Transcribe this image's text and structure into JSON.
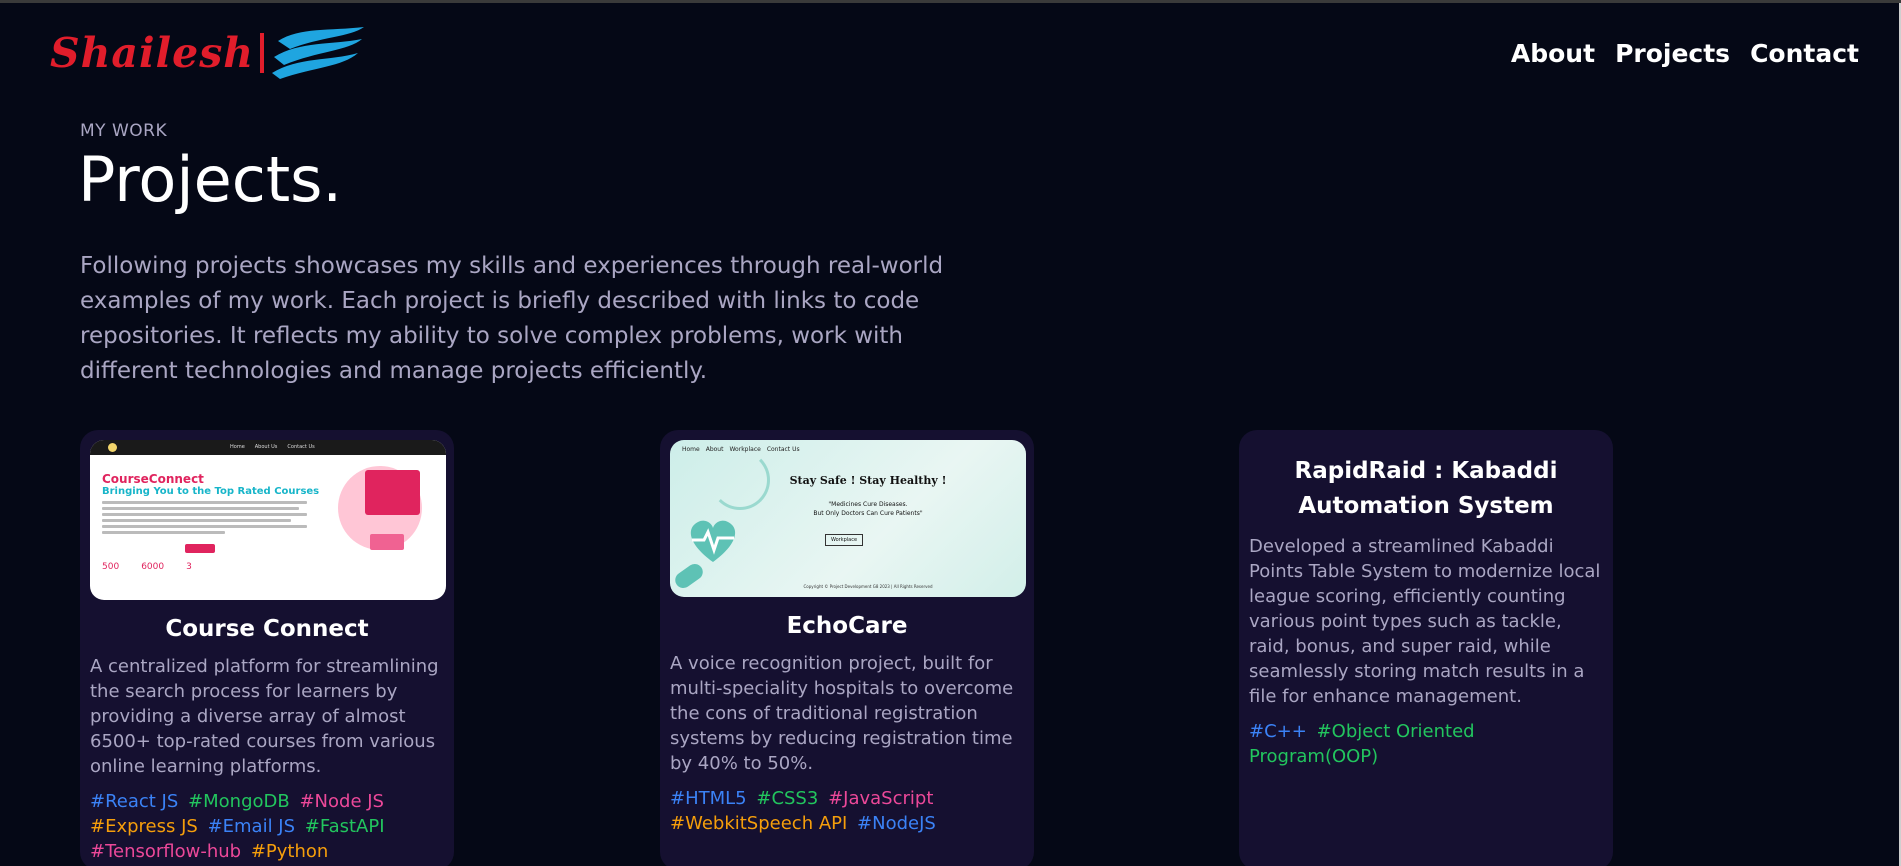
{
  "header": {
    "logo_text": "Shailesh",
    "nav": [
      "About",
      "Projects",
      "Contact"
    ]
  },
  "intro": {
    "eyebrow": "MY WORK",
    "title": "Projects.",
    "paragraph": "Following projects showcases my skills and experiences through real-world examples of my work. Each project is briefly described with links to code repositories. It reflects my ability to solve complex problems, work with different technologies and manage projects efficiently."
  },
  "projects": [
    {
      "title": "Course Connect",
      "description": "A centralized platform for streamlining the search process for learners by providing a diverse array of almost 6500+ top-rated courses from various online learning platforms.",
      "tags": [
        {
          "name": "#React JS",
          "color": "#3b82f6"
        },
        {
          "name": "#MongoDB",
          "color": "#22c55e"
        },
        {
          "name": "#Node JS",
          "color": "#ec4899"
        },
        {
          "name": "#Express JS",
          "color": "#f59e0b"
        },
        {
          "name": "#Email JS",
          "color": "#3b82f6"
        },
        {
          "name": "#FastAPI",
          "color": "#22c55e"
        },
        {
          "name": "#Tensorflow-hub",
          "color": "#ec4899"
        },
        {
          "name": "#Python",
          "color": "#f59e0b"
        }
      ],
      "screenshot": {
        "nav": [
          "Home",
          "About Us",
          "Contact Us"
        ],
        "heading": "CourseConnect",
        "subheading": "Bringing You to the Top Rated Courses",
        "stats": [
          "500",
          "6000",
          "3"
        ]
      }
    },
    {
      "title": "EchoCare",
      "description": "A voice recognition project, built for multi-speciality hospitals to overcome the cons of traditional registration systems by reducing registration time by 40% to 50%.",
      "tags": [
        {
          "name": "#HTML5",
          "color": "#3b82f6"
        },
        {
          "name": "#CSS3",
          "color": "#22c55e"
        },
        {
          "name": "#JavaScript",
          "color": "#ec4899"
        },
        {
          "name": "#WebkitSpeech API",
          "color": "#f59e0b"
        },
        {
          "name": "#NodeJS",
          "color": "#3b82f6"
        }
      ],
      "screenshot": {
        "nav": [
          "Home",
          "About",
          "Workplace",
          "Contact Us"
        ],
        "heading": "Stay Safe ! Stay Healthy !",
        "quote1": "\"Medicines Cure Diseases.",
        "quote2": "But Only Doctors Can Cure Patients\"",
        "button": "Workplace",
        "footer": "Copyright © Project Development G8 2023 | All Rights Reserved"
      }
    },
    {
      "title": "RapidRaid : Kabaddi Automation System",
      "description": "Developed a streamlined Kabaddi Points Table System to modernize local league scoring, efficiently counting various point types such as tackle, raid, bonus, and super raid, while seamlessly storing match results in a file for enhance management.",
      "tags": [
        {
          "name": "#C++",
          "color": "#3b82f6"
        },
        {
          "name": "#Object Oriented Program(OOP)",
          "color": "#22c55e"
        }
      ]
    }
  ]
}
